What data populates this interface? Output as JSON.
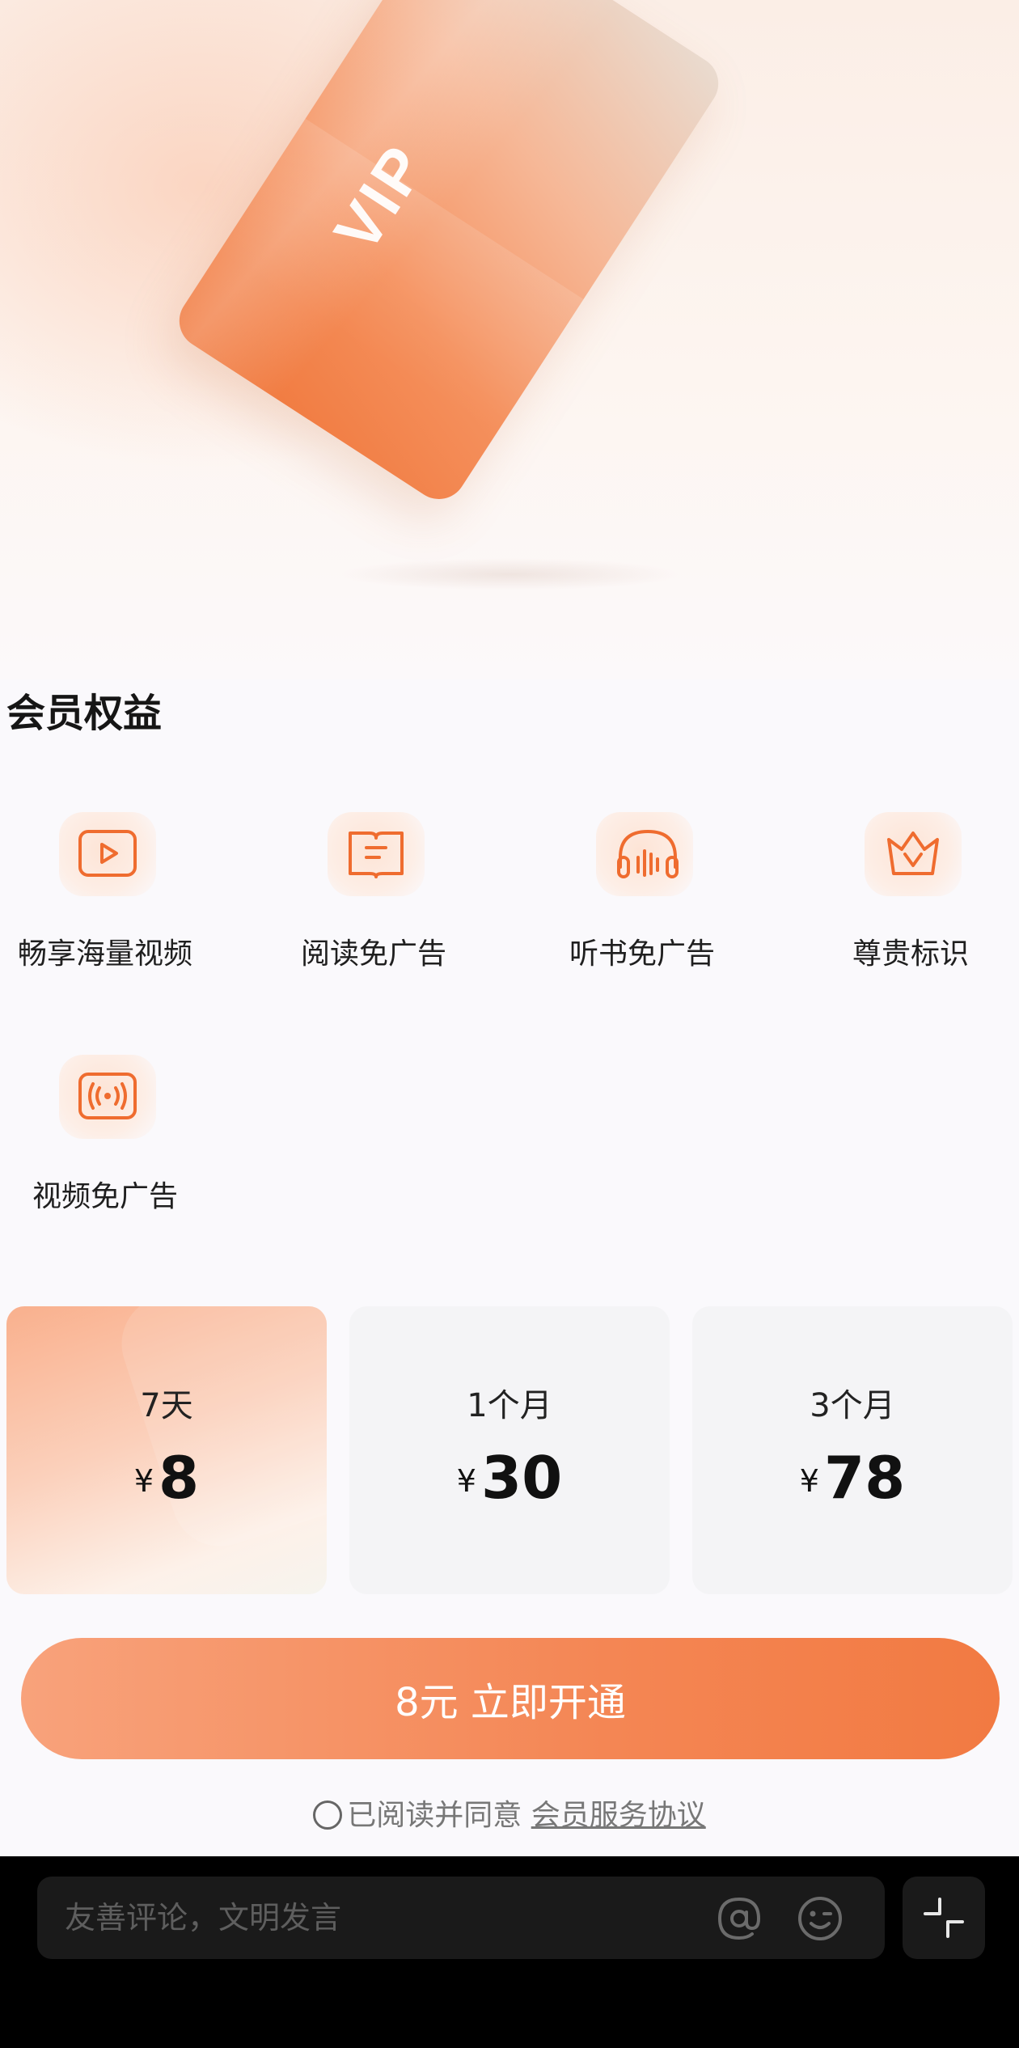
{
  "hero": {
    "card_text": "VIP"
  },
  "benefits": {
    "title": "会员权益",
    "items": [
      {
        "label": "畅享海量视频",
        "icon": "video-play-icon"
      },
      {
        "label": "阅读免广告",
        "icon": "book-icon"
      },
      {
        "label": "听书免广告",
        "icon": "headphones-icon"
      },
      {
        "label": "尊贵标识",
        "icon": "crown-icon"
      },
      {
        "label": "视频免广告",
        "icon": "broadcast-icon"
      }
    ]
  },
  "plans": [
    {
      "period": "7天",
      "currency": "¥",
      "price": "8",
      "selected": true
    },
    {
      "period": "1个月",
      "currency": "¥",
      "price": "30",
      "selected": false
    },
    {
      "period": "3个月",
      "currency": "¥",
      "price": "78",
      "selected": false
    }
  ],
  "cta": {
    "label": "8元 立即开通"
  },
  "agreement": {
    "text": "已阅读并同意",
    "link": "会员服务协议"
  },
  "comment_bar": {
    "placeholder": "友善评论，文明发言"
  },
  "colors": {
    "accent": "#f48654",
    "icon_stroke": "#ef6c2f",
    "plan_bg": "#f4f4f6",
    "bar_bg": "#000000"
  }
}
